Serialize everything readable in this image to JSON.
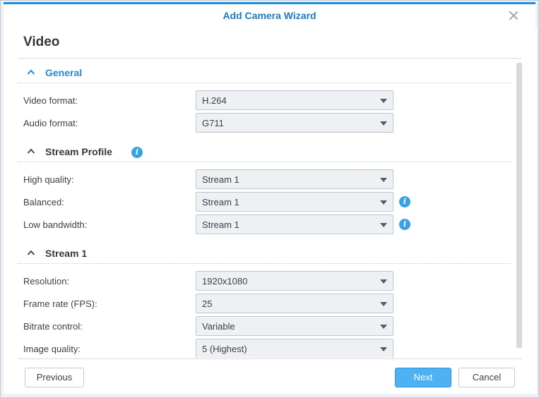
{
  "window": {
    "title": "Add Camera Wizard"
  },
  "page": {
    "title": "Video"
  },
  "sections": {
    "general": {
      "title": "General",
      "video_format": {
        "label": "Video format:",
        "value": "H.264"
      },
      "audio_format": {
        "label": "Audio format:",
        "value": "G711"
      }
    },
    "stream_profile": {
      "title": "Stream Profile",
      "high_quality": {
        "label": "High quality:",
        "value": "Stream 1"
      },
      "balanced": {
        "label": "Balanced:",
        "value": "Stream 1"
      },
      "low_bandwidth": {
        "label": "Low bandwidth:",
        "value": "Stream 1"
      }
    },
    "stream1": {
      "title": "Stream 1",
      "resolution": {
        "label": "Resolution:",
        "value": "1920x1080"
      },
      "frame_rate": {
        "label": "Frame rate (FPS):",
        "value": "25"
      },
      "bitrate_control": {
        "label": "Bitrate control:",
        "value": "Variable"
      },
      "image_quality": {
        "label": "Image quality:",
        "value": "5 (Highest)"
      }
    }
  },
  "footer": {
    "previous_label": "Previous",
    "next_label": "Next",
    "cancel_label": "Cancel"
  },
  "icons": {
    "close": "close-icon",
    "chevron": "chevron-up-icon",
    "info": "info-icon"
  },
  "colors": {
    "accent": "#1e8ddc",
    "primary_button": "#4eb2f2",
    "info": "#3ba1e6"
  }
}
